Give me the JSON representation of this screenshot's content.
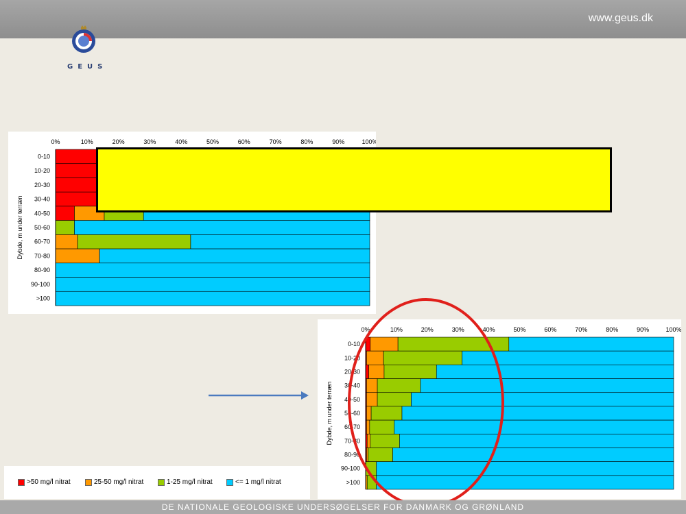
{
  "header": {
    "url": "www.geus.dk"
  },
  "logo": {
    "text": "GEUS"
  },
  "footer": {
    "text": "DE NATIONALE GEOLOGISKE UNDERSØGELSER FOR DANMARK OG GRØNLAND"
  },
  "colors": {
    "gt50": "#ff0000",
    "c25_50": "#ff9900",
    "c1_25": "#99cc00",
    "le1": "#00ccff"
  },
  "legend": [
    {
      "label": ">50 mg/l nitrat",
      "color": "#ff0000"
    },
    {
      "label": "25-50 mg/l nitrat",
      "color": "#ff9900"
    },
    {
      "label": "1-25 mg/l nitrat",
      "color": "#99cc00"
    },
    {
      "label": "<= 1 mg/l nitrat",
      "color": "#00ccff"
    }
  ],
  "chart_data": [
    {
      "type": "bar",
      "orientation": "horizontal-stacked-100",
      "ylabel": "Dybde, m under terræn",
      "x_ticks": [
        "0%",
        "10%",
        "20%",
        "30%",
        "40%",
        "50%",
        "60%",
        "70%",
        "80%",
        "90%",
        "100%"
      ],
      "categories": [
        "0-10",
        "10-20",
        "20-30",
        "30-40",
        "40-50",
        "50-60",
        "60-70",
        "70-80",
        "80-90",
        "90-100",
        ">100"
      ],
      "series": [
        {
          "name": ">50 mg/l nitrat",
          "values": [
            13,
            13,
            13,
            13,
            6,
            0,
            0,
            0,
            0,
            0,
            0
          ]
        },
        {
          "name": "25-50 mg/l nitrat",
          "values": [
            0,
            0,
            0,
            0,
            9.5,
            0,
            7,
            14,
            0,
            0,
            0
          ]
        },
        {
          "name": "1-25 mg/l nitrat",
          "values": [
            0,
            0,
            0,
            0,
            12.5,
            6,
            36,
            0,
            0,
            0,
            0
          ]
        },
        {
          "name": "<= 1 mg/l nitrat",
          "values": [
            87,
            87,
            87,
            87,
            72,
            94,
            57,
            86,
            100,
            100,
            100
          ]
        }
      ]
    },
    {
      "type": "bar",
      "orientation": "horizontal-stacked-100",
      "ylabel": "Dybde, m under terræn",
      "x_ticks": [
        "0%",
        "10%",
        "20%",
        "30%",
        "40%",
        "50%",
        "60%",
        "70%",
        "80%",
        "90%",
        "100%"
      ],
      "categories": [
        "0-10",
        "10-20",
        "20-30",
        "30-40",
        "40-50",
        "50-60",
        "60-70",
        "70-80",
        "80-90",
        "90-100",
        ">100"
      ],
      "series": [
        {
          "name": ">50 mg/l nitrat",
          "values": [
            1.5,
            0.3,
            1,
            0.3,
            0.3,
            0.3,
            0.3,
            0.5,
            0.3,
            0,
            0
          ]
        },
        {
          "name": "25-50 mg/l nitrat",
          "values": [
            9,
            5.5,
            5,
            3.5,
            3.5,
            1.5,
            1,
            1,
            0.5,
            0,
            0.5
          ]
        },
        {
          "name": "1-25 mg/l nitrat",
          "values": [
            36,
            25.5,
            17,
            14,
            11,
            10,
            8,
            9.5,
            8,
            3.5,
            3
          ]
        },
        {
          "name": "<= 1 mg/l nitrat",
          "values": [
            53.5,
            68.7,
            77,
            82.2,
            85.2,
            88.2,
            90.7,
            89,
            91.2,
            96.5,
            96.5
          ]
        }
      ]
    }
  ]
}
